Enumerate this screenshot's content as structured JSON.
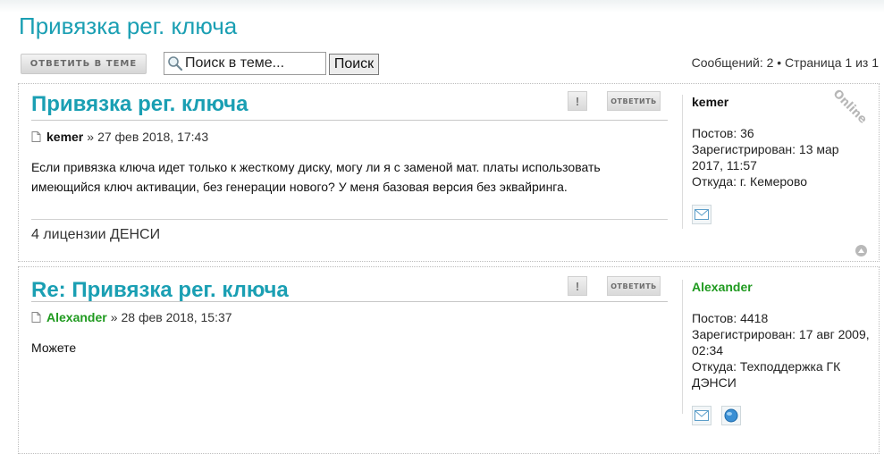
{
  "topic": {
    "title": "Привязка рег. ключа"
  },
  "toolbar": {
    "reply_label": "Ответить в теме",
    "search_placeholder": "Поиск в теме...",
    "search_button": "Поиск",
    "pagination": "Сообщений: 2 • Страница 1 из 1"
  },
  "actions": {
    "report_label": "!",
    "quote_label": "Ответить"
  },
  "posts": [
    {
      "title": "Привязка рег. ключа",
      "author": "kemer",
      "date_sep": "»",
      "date": "27 фев 2018, 17:43",
      "content": "Если привязка ключа идет только к жесткому диску, могу ли я с заменой мат. платы использовать имеющийся ключ активации, без генерации нового? У меня базовая версия без эквайринга.",
      "signature": "4 лицензии ДЕНСИ",
      "online_badge": "Online",
      "profile": {
        "username": "kemer",
        "posts_label": "Постов:",
        "posts": "36",
        "registered_label": "Зарегистрирован:",
        "registered": "13 мар 2017, 11:57",
        "from_label": "Откуда:",
        "from": "г. Кемерово"
      }
    },
    {
      "title": "Re: Привязка рег. ключа",
      "author": "Alexander",
      "date_sep": "»",
      "date": "28 фев 2018, 15:37",
      "content": "Можете",
      "profile": {
        "username": "Alexander",
        "posts_label": "Постов:",
        "posts": "4418",
        "registered_label": "Зарегистрирован:",
        "registered": "17 авг 2009, 02:34",
        "from_label": "Откуда:",
        "from": "Техподдержка ГК ДЭНСИ"
      }
    }
  ],
  "colors": {
    "title": "#1a9fb3",
    "moderator_name": "#1f9a1f"
  },
  "icons": [
    "search-icon",
    "post-icon",
    "email-icon",
    "website-icon",
    "back-to-top-icon"
  ]
}
